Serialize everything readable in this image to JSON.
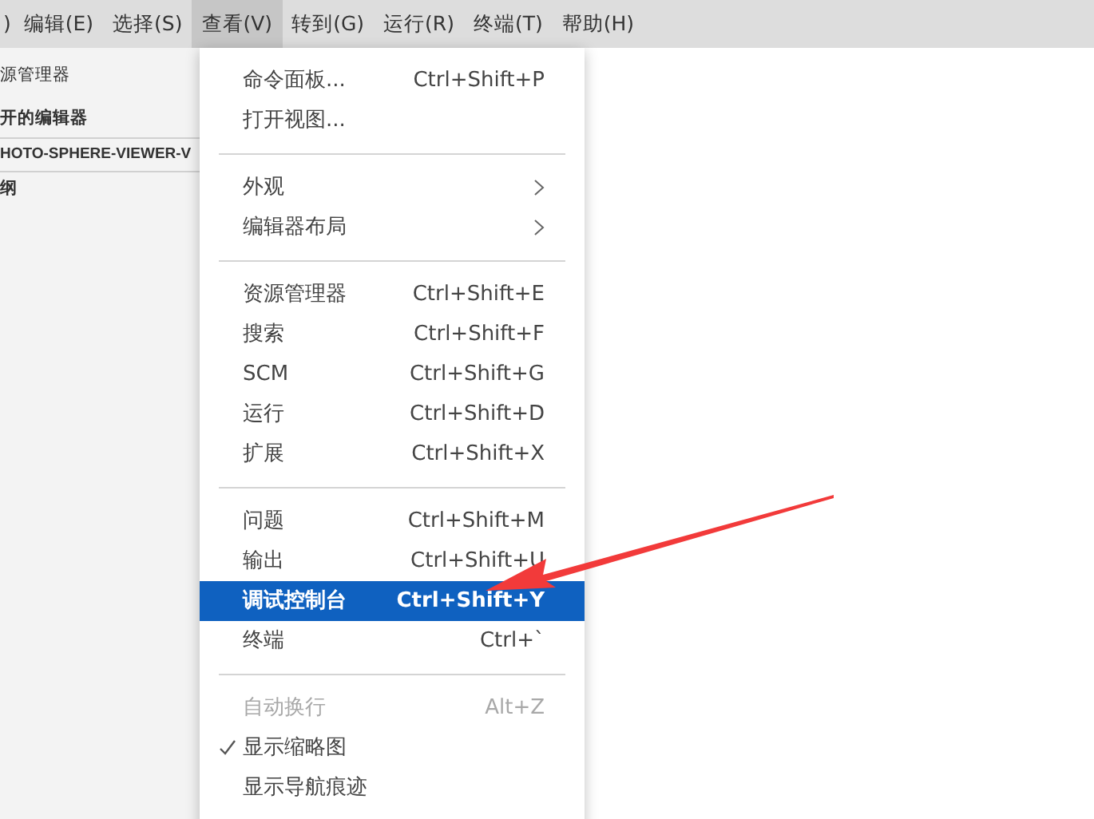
{
  "menu_bar": [
    {
      "label": ")",
      "selected": false
    },
    {
      "label": "编辑(E)",
      "selected": false
    },
    {
      "label": "选择(S)",
      "selected": false
    },
    {
      "label": "查看(V)",
      "selected": true
    },
    {
      "label": "转到(G)",
      "selected": false
    },
    {
      "label": "运行(R)",
      "selected": false
    },
    {
      "label": "终端(T)",
      "selected": false
    },
    {
      "label": "帮助(H)",
      "selected": false
    }
  ],
  "sidebar": {
    "items": [
      {
        "label": "源管理器",
        "kind": "title"
      },
      {
        "label": "开的编辑器",
        "kind": "section"
      },
      {
        "label": "HOTO-SPHERE-VIEWER-V",
        "kind": "section"
      },
      {
        "label": "纲",
        "kind": "section"
      }
    ]
  },
  "view_menu": {
    "groups": [
      [
        {
          "label": "命令面板...",
          "shortcut": "Ctrl+Shift+P",
          "kind": "item",
          "selected": false,
          "disabled": false,
          "checked": false
        },
        {
          "label": "打开视图...",
          "kind": "item",
          "selected": false,
          "disabled": false,
          "checked": false
        }
      ],
      [
        {
          "label": "外观",
          "kind": "submenu",
          "selected": false,
          "disabled": false,
          "checked": false
        },
        {
          "label": "编辑器布局",
          "kind": "submenu",
          "selected": false,
          "disabled": false,
          "checked": false
        }
      ],
      [
        {
          "label": "资源管理器",
          "shortcut": "Ctrl+Shift+E",
          "kind": "item",
          "selected": false,
          "disabled": false,
          "checked": false
        },
        {
          "label": "搜索",
          "shortcut": "Ctrl+Shift+F",
          "kind": "item",
          "selected": false,
          "disabled": false,
          "checked": false
        },
        {
          "label": "SCM",
          "shortcut": "Ctrl+Shift+G",
          "kind": "item",
          "selected": false,
          "disabled": false,
          "checked": false
        },
        {
          "label": "运行",
          "shortcut": "Ctrl+Shift+D",
          "kind": "item",
          "selected": false,
          "disabled": false,
          "checked": false
        },
        {
          "label": "扩展",
          "shortcut": "Ctrl+Shift+X",
          "kind": "item",
          "selected": false,
          "disabled": false,
          "checked": false
        }
      ],
      [
        {
          "label": "问题",
          "shortcut": "Ctrl+Shift+M",
          "kind": "item",
          "selected": false,
          "disabled": false,
          "checked": false
        },
        {
          "label": "输出",
          "shortcut": "Ctrl+Shift+U",
          "kind": "item",
          "selected": false,
          "disabled": false,
          "checked": false
        },
        {
          "label": "调试控制台",
          "shortcut": "Ctrl+Shift+Y",
          "kind": "item",
          "selected": true,
          "disabled": false,
          "checked": false
        },
        {
          "label": "终端",
          "shortcut": "Ctrl+`",
          "kind": "item",
          "selected": false,
          "disabled": false,
          "checked": false
        }
      ],
      [
        {
          "label": "自动换行",
          "shortcut": "Alt+Z",
          "kind": "item",
          "selected": false,
          "disabled": true,
          "checked": false
        },
        {
          "label": "显示缩略图",
          "kind": "item",
          "selected": false,
          "disabled": false,
          "checked": true
        },
        {
          "label": "显示导航痕迹",
          "kind": "item",
          "selected": false,
          "disabled": false,
          "checked": false
        }
      ]
    ]
  }
}
